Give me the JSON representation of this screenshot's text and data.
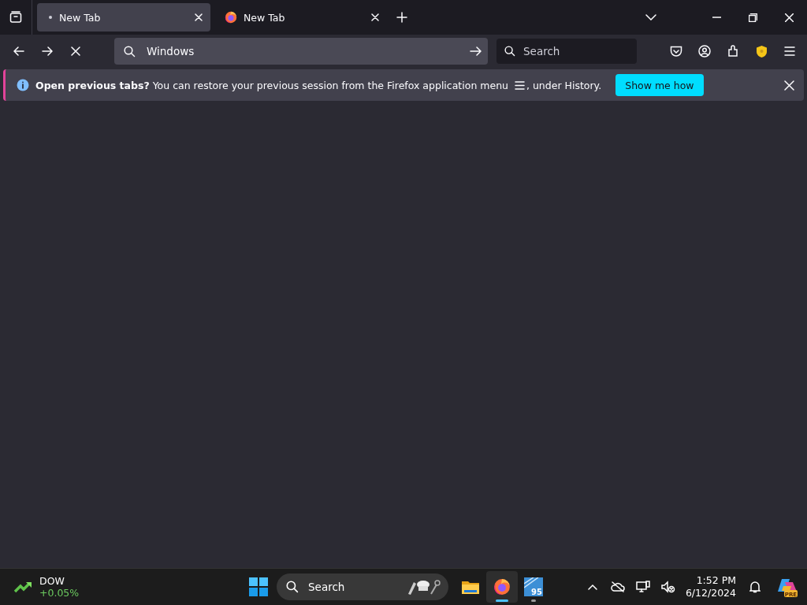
{
  "tabs": [
    {
      "title": "New Tab",
      "kind": "loading",
      "selected": true
    },
    {
      "title": "New Tab",
      "kind": "firefox",
      "selected": false
    }
  ],
  "navbar": {
    "url_value": "Windows",
    "search_placeholder": "Search"
  },
  "infobar": {
    "message": "**Open previous tabs?** You can restore your previous session from the Firefox application menu",
    "message_end": ", under History.",
    "button": "Show me how"
  },
  "taskbar": {
    "ticker": {
      "name": "DOW",
      "change": "+0.05%"
    },
    "search_placeholder": "Search",
    "apps": [
      {
        "kind": "folder",
        "running": false,
        "active": false
      },
      {
        "kind": "firefox",
        "running": true,
        "active": true
      },
      {
        "kind": "tile",
        "badge": "95",
        "running": true,
        "active": false
      }
    ],
    "time": "1:52 PM",
    "date": "6/12/2024",
    "copilot_badge": "PRE"
  }
}
